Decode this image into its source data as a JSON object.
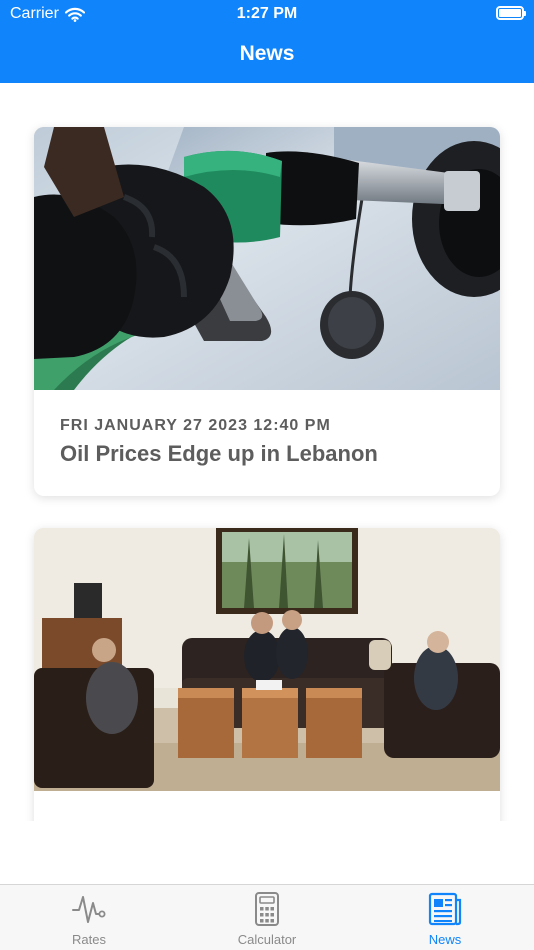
{
  "status_bar": {
    "carrier": "Carrier",
    "time": "1:27 PM"
  },
  "header": {
    "title": "News"
  },
  "colors": {
    "accent": "#0f84fb",
    "tab_inactive": "#8a8a8a",
    "text_gray": "#5d5d5d"
  },
  "news": [
    {
      "date": "FRI JANUARY 27 2023 12:40 PM",
      "title": "Oil Prices Edge up in Lebanon",
      "image": "fuel-nozzle-photo"
    },
    {
      "date": "",
      "title": "",
      "image": "meeting-room-photo"
    }
  ],
  "tabs": [
    {
      "label": "Rates",
      "icon": "pulse-icon",
      "active": false
    },
    {
      "label": "Calculator",
      "icon": "calculator-icon",
      "active": false
    },
    {
      "label": "News",
      "icon": "newspaper-icon",
      "active": true
    }
  ]
}
